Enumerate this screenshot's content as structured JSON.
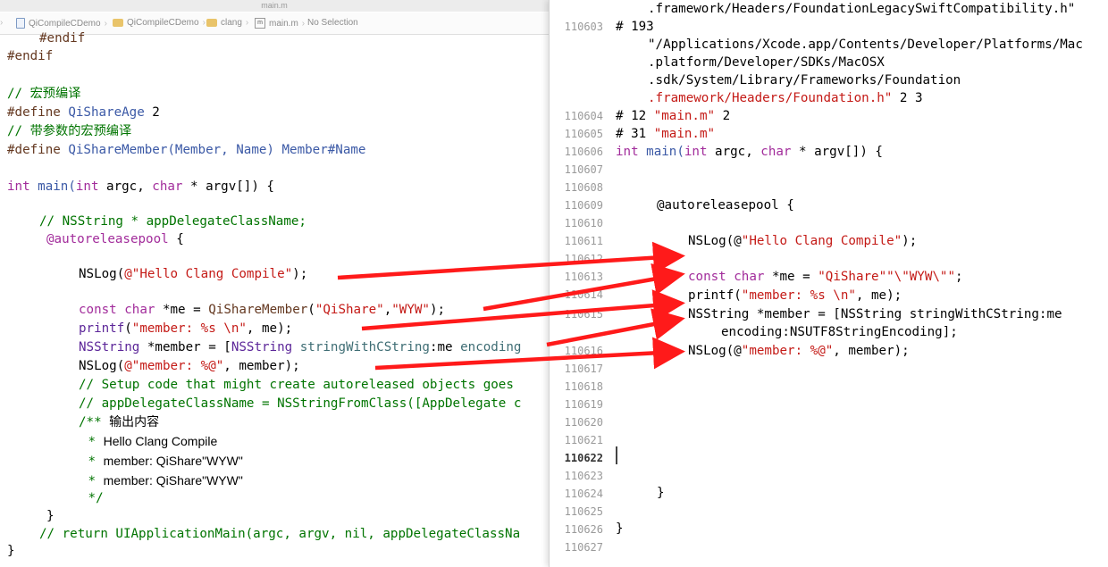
{
  "window": {
    "title": "main.m"
  },
  "jumpbar": {
    "crumbs": [
      "QiCompileCDemo",
      "QiCompileCDemo",
      "clang",
      "main.m",
      "No Selection"
    ]
  },
  "left_editor": {
    "lines": {
      "l1": "#endif",
      "l2": "#endif",
      "l3": "// 宏预编译",
      "l4a": "#define",
      "l4b": " QiShareAge",
      "l4c": " 2",
      "l5": "// 带参数的宏预编译",
      "l6a": "#define",
      "l6b": " QiShareMember(Member, Name) Member#Name",
      "l7a": "int",
      "l7b": " main(",
      "l7c": "int",
      "l7d": " argc, ",
      "l7e": "char",
      "l7f": " * argv[]) {",
      "l8": "// NSString * appDelegateClassName;",
      "l9": "@autoreleasepool",
      "l9b": " {",
      "l10a": "NSLog(",
      "l10b": "@\"Hello Clang Compile\"",
      "l10c": ");",
      "l11a": "const",
      "l11b": " ",
      "l11c": "char",
      "l11d": " *me = ",
      "l11e": "QiShareMember",
      "l11f": "(",
      "l11g": "\"QiShare\"",
      "l11h": ",",
      "l11i": "\"WYW\"",
      "l11j": ");",
      "l12a": "printf",
      "l12b": "(",
      "l12c": "\"member: %s \\n\"",
      "l12d": ", me);",
      "l13a": "NSString",
      "l13b": " *member = [",
      "l13c": "NSString",
      "l13d": " ",
      "l13e": "stringWithCString",
      "l13f": ":me ",
      "l13g": "encoding",
      "l14a": "NSLog(",
      "l14b": "@\"member: %@\"",
      "l14c": ", member);",
      "l15": "// Setup code that might create autoreleased objects goes",
      "l16": "// appDelegateClassName = NSStringFromClass([AppDelegate c",
      "l17a": "/** ",
      "l17b": "输出内容",
      "l18a": " * ",
      "l18b": "Hello Clang Compile",
      "l19a": " * ",
      "l19b": "member: QiShare\"WYW\"",
      "l20a": " * ",
      "l20b": "member: QiShare\"WYW\"",
      "l21": " */",
      "l22": "}",
      "l23": "// return UIApplicationMain(argc, argv, nil, appDelegateClassNa",
      "l24": "}"
    }
  },
  "right_panel": {
    "line_numbers": [
      "110603",
      "110604",
      "110605",
      "110606",
      "110607",
      "110608",
      "110609",
      "110610",
      "110611",
      "110612",
      "110613",
      "110614",
      "110615",
      "110616",
      "110617",
      "110618",
      "110619",
      "110620",
      "110621",
      "110622",
      "110623",
      "110624",
      "110625",
      "110626",
      "110627"
    ],
    "current_line": "110622",
    "code": {
      "r0": ".framework/Headers/FoundationLegacySwiftCompatibility.h\"",
      "r1a": "# 193",
      "r2": "\"/Applications/Xcode.app/Contents/Developer/Platforms/Mac",
      "r3": ".platform/Developer/SDKs/MacOSX",
      "r4": ".sdk/System/Library/Frameworks/Foundation",
      "r5a": ".framework/Headers/Foundation.h\"",
      "r5b": " 2 3",
      "r6a": "# 12 ",
      "r6b": "\"main.m\"",
      "r6c": " 2",
      "r7a": "# 31 ",
      "r7b": "\"main.m\"",
      "r8a": "int",
      "r8b": " main(",
      "r8c": "int",
      "r8d": " argc, ",
      "r8e": "char",
      "r8f": " * argv[]) {",
      "r9": "@autoreleasepool {",
      "r10a": "NSLog(@",
      "r10b": "\"Hello Clang Compile\"",
      "r10c": ");",
      "r11a": "const",
      "r11b": " ",
      "r11c": "char",
      "r11d": " *me = ",
      "r11e": "\"QiShare\"\"\\\"WYW\\\"\"",
      "r11f": ";",
      "r12a": "printf(",
      "r12b": "\"member: %s \\n\"",
      "r12c": ", me);",
      "r13": "NSString *member = [NSString stringWithCString:me",
      "r14": "encoding:NSUTF8StringEncoding];",
      "r15a": "NSLog(@",
      "r15b": "\"member: %@\"",
      "r15c": ", member);",
      "r16": "}",
      "r17": "}"
    }
  },
  "colors": {
    "keyword": "#a22c9b",
    "string": "#c41a16",
    "comment": "#007400",
    "arrow": "#ff1a1a"
  }
}
